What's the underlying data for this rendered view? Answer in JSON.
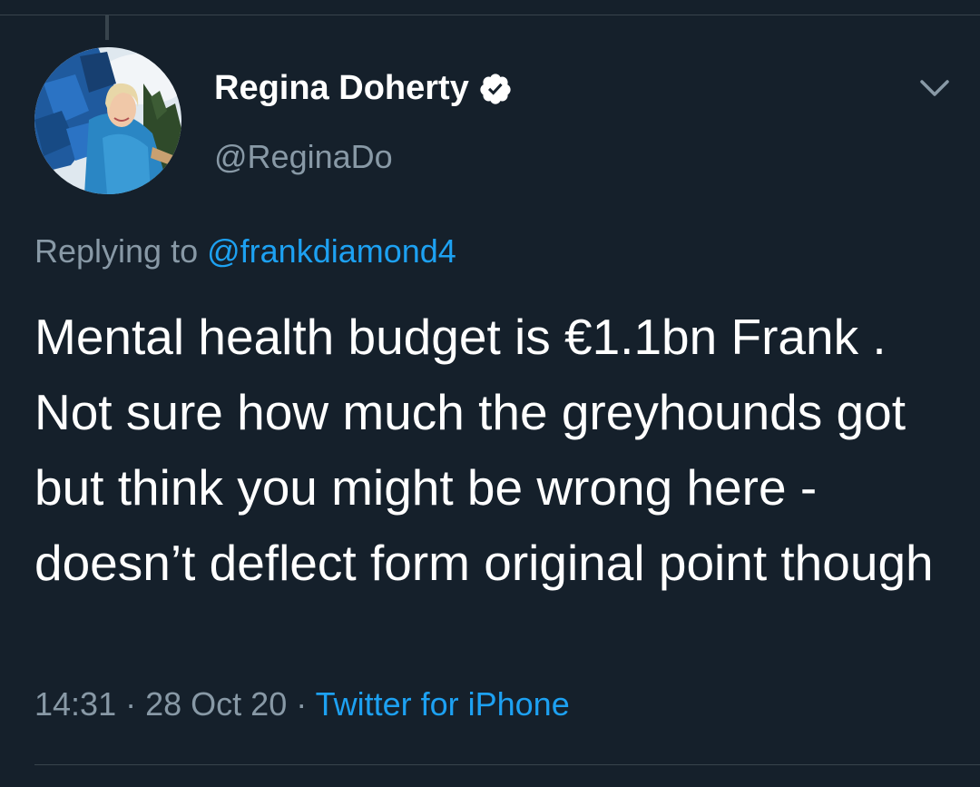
{
  "tweet": {
    "display_name": "Regina Doherty",
    "handle": "@ReginaDo",
    "verified": true,
    "replying_prefix": "Replying to",
    "replying_to": "@frankdiamond4",
    "text": "Mental health budget is €1.1bn Frank . Not sure how much the greyhounds got but think you might be wrong here - doesn’t deflect form original point though",
    "time": "14:31",
    "date": "28 Oct 20",
    "separator": "·",
    "source": "Twitter for iPhone"
  },
  "icons": {
    "verified": "verified-badge-icon",
    "menu": "chevron-down-icon"
  },
  "colors": {
    "background": "#15202b",
    "text_primary": "#ffffff",
    "text_secondary": "#8899a6",
    "accent": "#1da1f2",
    "divider": "#38444d"
  }
}
